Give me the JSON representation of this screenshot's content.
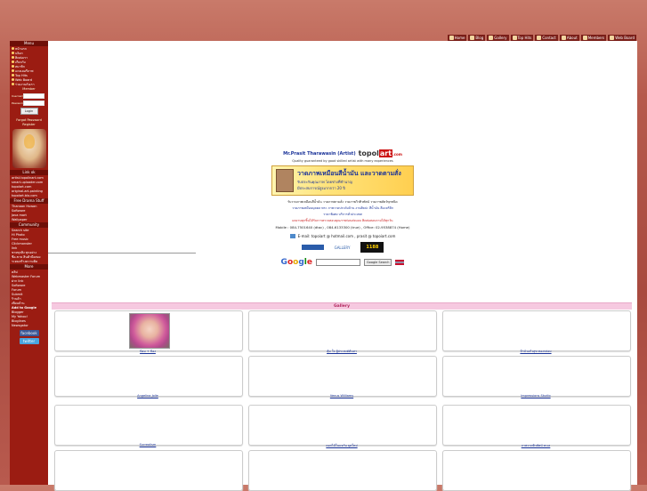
{
  "topnav": [
    {
      "label": "Home"
    },
    {
      "label": "Blog"
    },
    {
      "label": "Gallery"
    },
    {
      "label": "Top Hits"
    },
    {
      "label": "Contact"
    },
    {
      "label": "About"
    },
    {
      "label": "Members"
    },
    {
      "label": "Web Board"
    }
  ],
  "sidebar": {
    "menu_title": "Menu",
    "menu_items": [
      "หน้าแรก",
      "บล็อก",
      "ติดต่อเรา",
      "เกี่ยวกับ",
      "สมาชิก",
      "แกลเลอรี่ภาพ",
      "Top Hits",
      "Web Board",
      "ร่วมงานกับเรา"
    ],
    "login_title": "Member",
    "user_label": "Username",
    "pass_label": "Password",
    "login_button": "Login",
    "forgot": "Forgot Password",
    "register": "Register",
    "links_title": "Link ok",
    "links": [
      "artist.topolinart.com",
      "smart-uploader.com",
      "topolart.com",
      "original-art-painting",
      "topolart.blo.com"
    ],
    "free_title": "Free Drama Stuff",
    "free_items": [
      "Thanaan Huwan",
      "Software",
      "Java mart",
      "Wallpaper"
    ],
    "community_title": "Community",
    "community_items": [
      "Search site",
      "Hi Photo",
      "Free music",
      "Clickmonster",
      "link",
      "ขายทุกสิ่ง ทุกอย่าง",
      "ซื้อ-ขาย สินค้ามือสอง",
      "ระดมสร้างความคิด"
    ],
    "extra_title": "More",
    "extra_items": [
      "คลิป",
      "Webmaster Forum",
      "ฝาก link",
      "Software",
      "Forum",
      "Submit",
      "ร้านค้า",
      "เพื่อนบ้าน"
    ],
    "add_title": "Add to Google",
    "add_items": [
      "Blogger",
      "My Yahoo!",
      "Bloglines",
      "Newsgator"
    ],
    "facebook": "facebook",
    "twitter": "twitter"
  },
  "center": {
    "artist_name": "Mr.Prasit Tharawasin (Artist)",
    "logo_pre": "topol",
    "logo_mid": "art",
    "logo_suf": ".com",
    "tagline": "Quality guaranteed by good skilled artist with many experiences",
    "banner_line1": "วาดภาพเหมือนสีน้ำมัน และวาดตามสั่ง",
    "banner_line2": "รับประกันคุณภาพ โดยช่างที่ชำนาญ",
    "banner_line3": "มีประสบการณ์สูงมากกว่า 20 ปี",
    "line1": "รับวาดภาพเหมือนสีน้ำมัน วาดภาพตามสั่ง วาดภาพวิวทิวทัศน์ วาดภาพสัตว์ทุกชนิด",
    "line2": "วาดภาพเหมือนบุคคล พระ ภาพวาดประดับบ้าน งานศิลปะ สีน้ำมัน สีอะคริลิก",
    "line3": "ราคาพิเศษ บริการทั่วประเทศ",
    "line4": "ผลงานทุกชิ้นได้รับการตรวจสอบคุณภาพก่อนส่งมอบ ติดต่อสอบถามได้ทุกวัน",
    "contact": "Mobile : 084-7501640 (dtac) , 084-6133300 (true) , Office: 02-9538874 (Home)",
    "email": "E-mail: topoiart @ hotmail.com ,  prasit @ topoiart.com",
    "badge1": "GALLERY",
    "badge2": "1188",
    "google_logo": [
      "G",
      "o",
      "o",
      "g",
      "l",
      "e"
    ],
    "google_button": "Google Search"
  },
  "gallery": {
    "title": "Gallery",
    "items": [
      {
        "caption": "ป้อม + ป้อง"
      },
      {
        "caption": "คุ้ม ใจ ผู้ประสงค์ค้นหา"
      },
      {
        "caption": "ป้าบัวแก้วสุข ทองกล่อม"
      },
      {
        "caption": "Angelina Jolie"
      },
      {
        "caption": "Venus Williams"
      },
      {
        "caption": "Impressions Studio"
      },
      {
        "caption": "Surrealism"
      },
      {
        "caption": "ดอกไม้ในแจกัน ยุคใหม่"
      },
      {
        "caption": "ภาพวาดทิวทัศน์ ทะเล"
      },
      {
        "caption": ""
      },
      {
        "caption": ""
      },
      {
        "caption": ""
      }
    ]
  }
}
